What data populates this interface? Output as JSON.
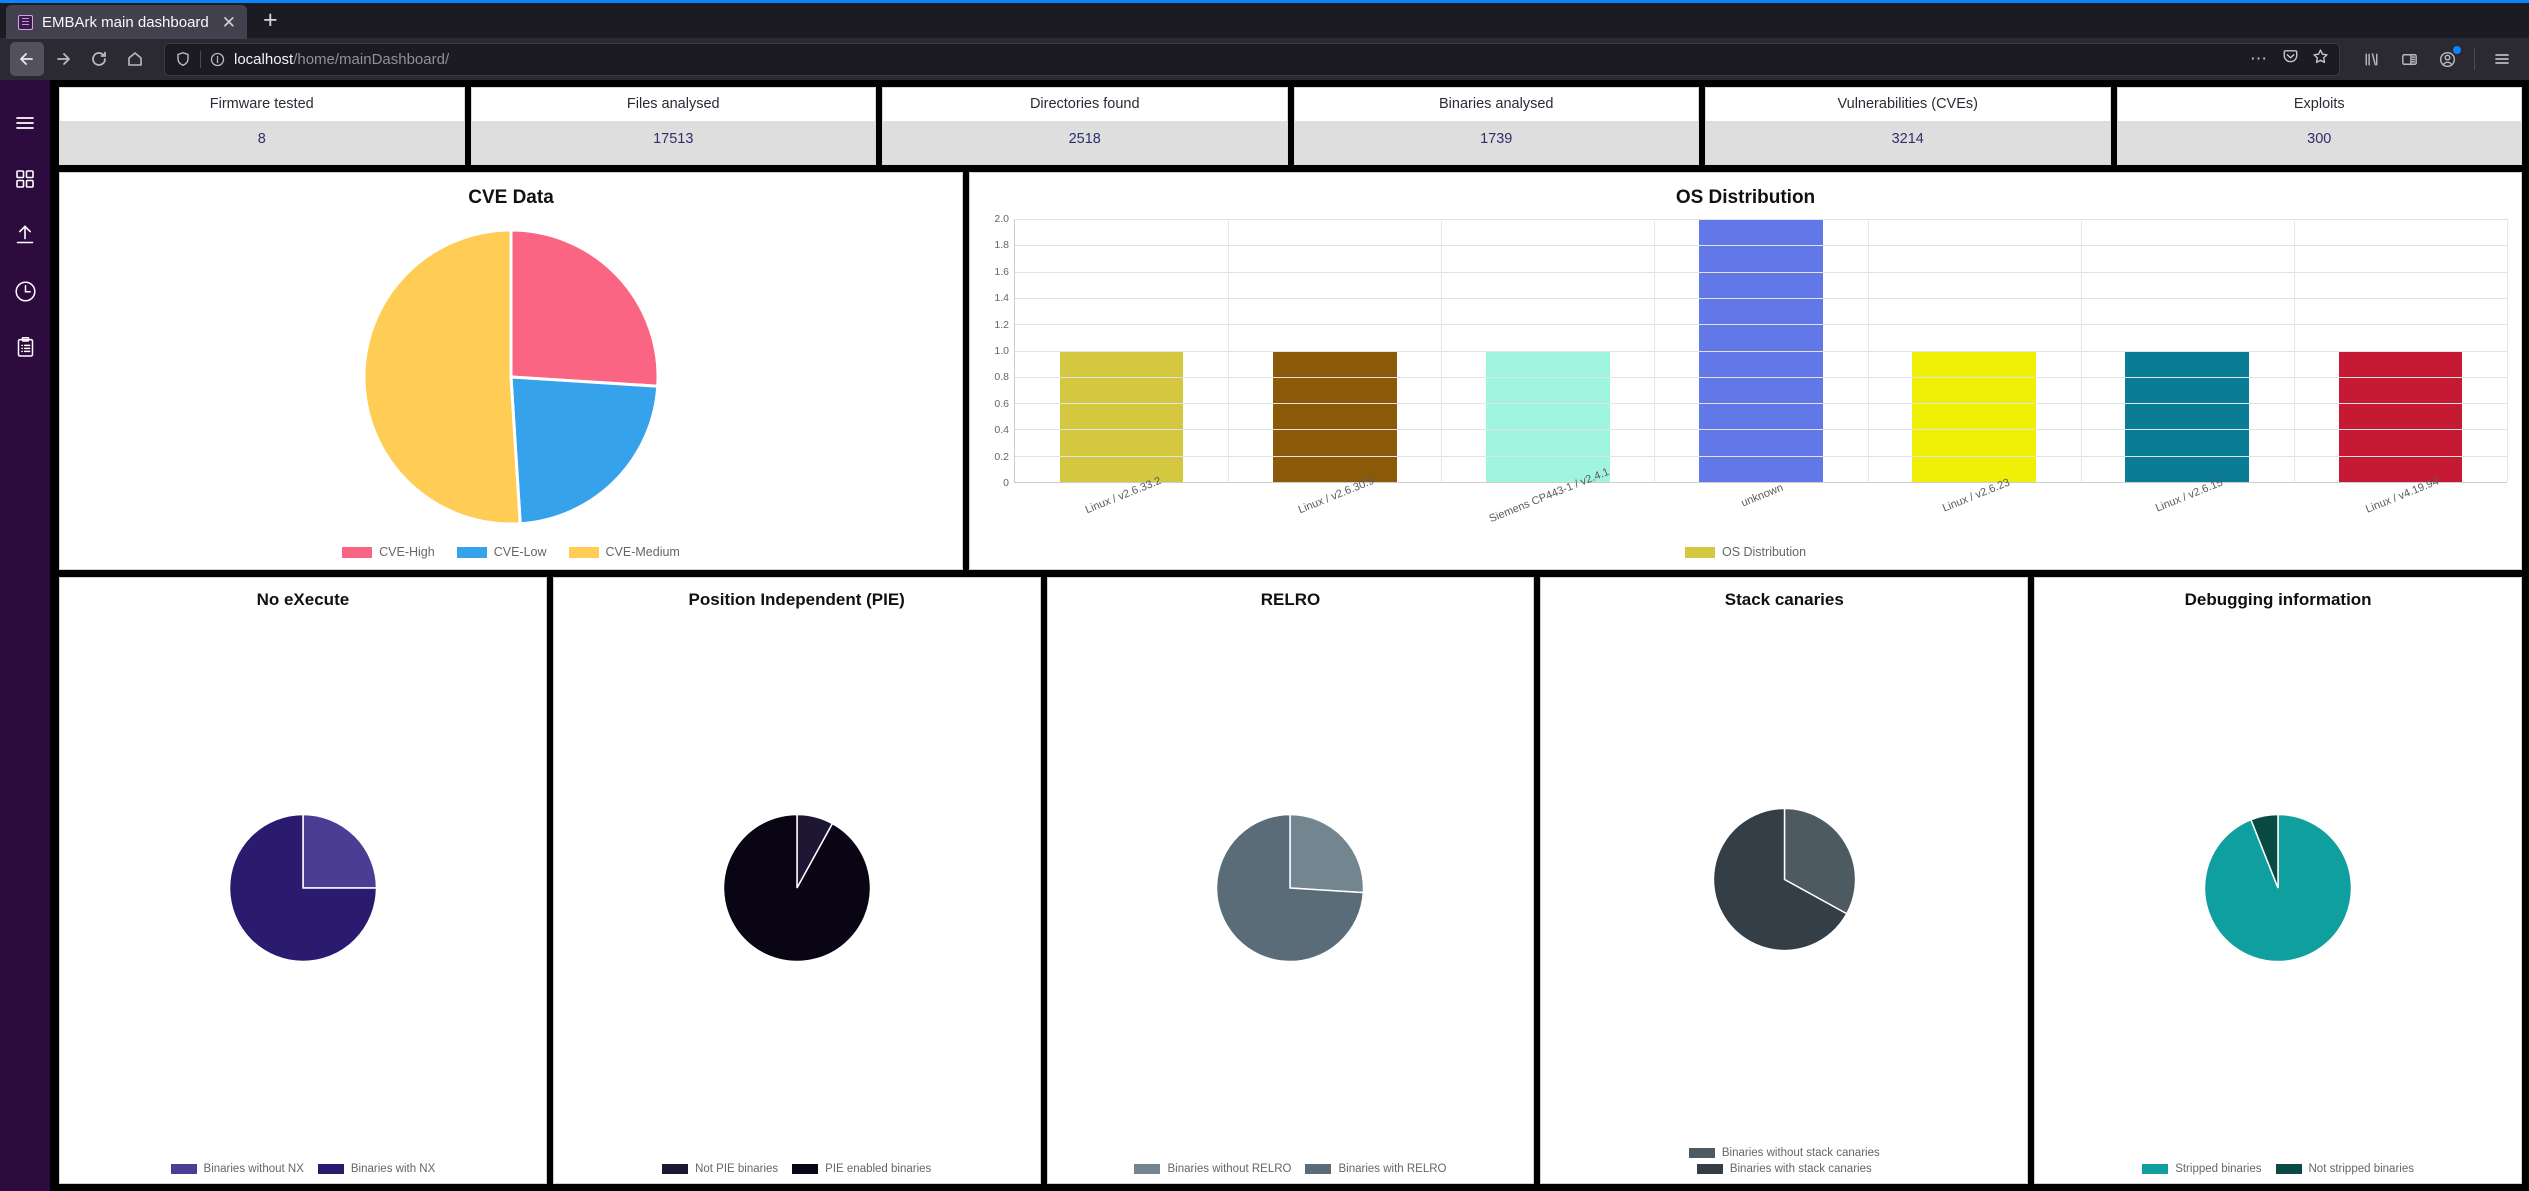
{
  "browser": {
    "tab_title": "EMBArk main dashboard",
    "tab_close": "✕",
    "new_tab": "+",
    "url_display_host": "localhost",
    "url_display_path": "/home/mainDashboard/",
    "back_icon": "back-arrow",
    "forward_icon": "forward-arrow",
    "reload_icon": "reload",
    "home_icon": "home",
    "shield_icon": "tracking-protection-shield",
    "info_icon": "site-information",
    "more_icon": "page-actions-ellipsis",
    "pocket_icon": "save-to-pocket",
    "star_icon": "bookmark-star",
    "library_icon": "library",
    "sidebar_icon": "sidebars",
    "account_icon": "firefox-account",
    "menu_icon": "application-menu"
  },
  "sidebar": {
    "items": [
      {
        "name": "hamburger-menu",
        "icon": "hamburger-icon"
      },
      {
        "name": "dashboard",
        "icon": "grid-icon"
      },
      {
        "name": "upload",
        "icon": "upload-arrow-icon"
      },
      {
        "name": "history",
        "icon": "clock-icon"
      },
      {
        "name": "reports",
        "icon": "clipboard-icon"
      }
    ]
  },
  "stats": [
    {
      "label": "Firmware tested",
      "value": "8"
    },
    {
      "label": "Files analysed",
      "value": "17513"
    },
    {
      "label": "Directories found",
      "value": "2518"
    },
    {
      "label": "Binaries analysed",
      "value": "1739"
    },
    {
      "label": "Vulnerabilities (CVEs)",
      "value": "3214"
    },
    {
      "label": "Exploits",
      "value": "300"
    }
  ],
  "panels": {
    "cve_title": "CVE Data",
    "os_title": "OS Distribution",
    "nx_title": "No eXecute",
    "pie_title": "Position Independent (PIE)",
    "relro_title": "RELRO",
    "canary_title": "Stack canaries",
    "debug_title": "Debugging information"
  },
  "chart_data": [
    {
      "type": "pie",
      "title": "CVE Data",
      "labels": [
        "CVE-High",
        "CVE-Low",
        "CVE-Medium"
      ],
      "values": [
        26,
        23,
        51
      ],
      "colors": [
        "#fb6584",
        "#36a2eb",
        "#ffcd56"
      ],
      "legend_position": "bottom"
    },
    {
      "type": "bar",
      "title": "OS Distribution",
      "categories": [
        "Linux / v2.6.33.2",
        "Linux / v2.6.30.9",
        "Siemens CP443-1 / v2.4.1",
        "unknown",
        "Linux / v2.6.23",
        "Linux / v2.6.15",
        "Linux / v4.19.94"
      ],
      "values": [
        1,
        1,
        1,
        2,
        1,
        1,
        1
      ],
      "bar_colors": [
        "#d4c840",
        "#8a5a08",
        "#9ff5dd",
        "#6378e8",
        "#f0f007",
        "#0a7c96",
        "#c51934"
      ],
      "ylim": [
        0,
        2
      ],
      "yticks": [
        "0",
        "0.2",
        "0.4",
        "0.6",
        "0.8",
        "1.0",
        "1.2",
        "1.4",
        "1.6",
        "1.8",
        "2.0"
      ],
      "legend": [
        {
          "label": "OS Distribution",
          "color": "#d4c840"
        }
      ],
      "xlabel": "",
      "ylabel": "",
      "grid": true,
      "legend_position": "bottom"
    },
    {
      "type": "pie",
      "title": "No eXecute",
      "labels": [
        "Binaries without NX",
        "Binaries with NX"
      ],
      "values": [
        25,
        75
      ],
      "colors": [
        "#4b3d94",
        "#2a1b6e"
      ],
      "legend_position": "bottom"
    },
    {
      "type": "pie",
      "title": "Position Independent (PIE)",
      "labels": [
        "Not PIE binaries",
        "PIE enabled binaries"
      ],
      "values": [
        8,
        92
      ],
      "colors": [
        "#1d1733",
        "#0a0514"
      ],
      "legend_position": "bottom"
    },
    {
      "type": "pie",
      "title": "RELRO",
      "labels": [
        "Binaries without RELRO",
        "Binaries with RELRO"
      ],
      "values": [
        26,
        74
      ],
      "colors": [
        "#73858f",
        "#5a6c78"
      ],
      "legend_position": "bottom"
    },
    {
      "type": "pie",
      "title": "Stack canaries",
      "labels": [
        "Binaries without stack canaries",
        "Binaries with stack canaries"
      ],
      "values": [
        33,
        67
      ],
      "colors": [
        "#4e5a62",
        "#333e46"
      ],
      "legend_position": "bottom"
    },
    {
      "type": "pie",
      "title": "Debugging information",
      "labels": [
        "Stripped binaries",
        "Not stripped binaries"
      ],
      "values": [
        94,
        6
      ],
      "colors": [
        "#0f9f9f",
        "#0a4a44"
      ],
      "legend_position": "bottom"
    }
  ],
  "theme": {
    "sidebar_bg": "#2d0b3f",
    "stat_value_color": "#2f2f6b",
    "stat_value_bg": "#dedede",
    "browser_chrome": "#2b2a33",
    "accent": "#0a84ff"
  }
}
